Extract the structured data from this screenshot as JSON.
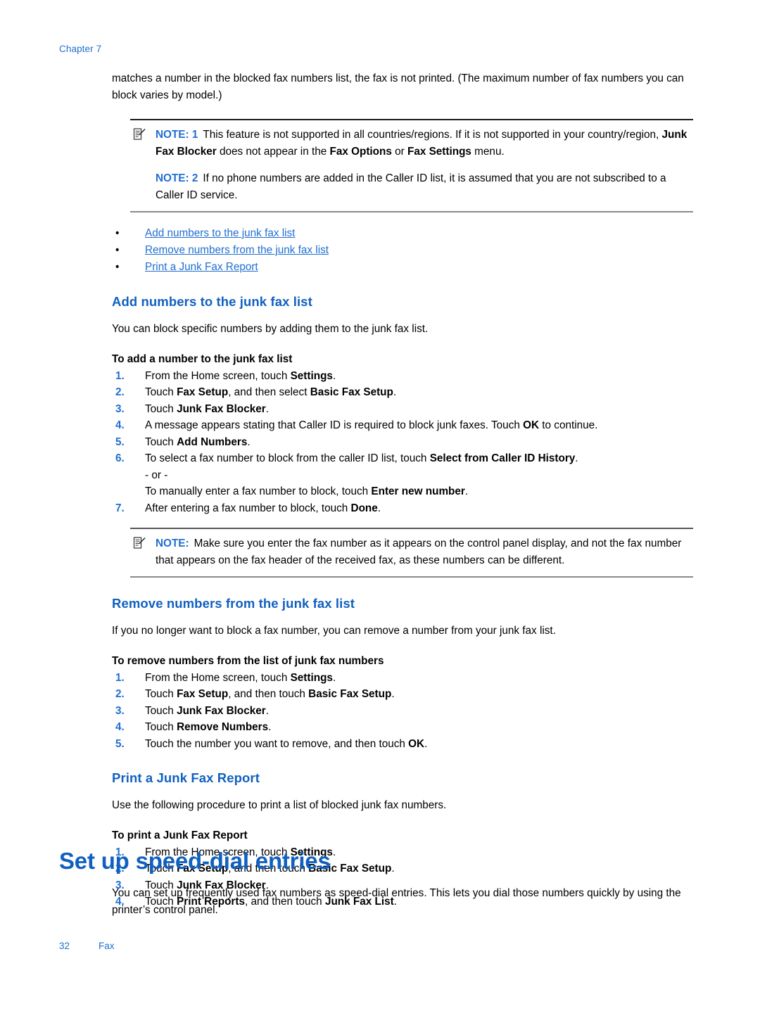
{
  "header": {
    "chapter": "Chapter 7"
  },
  "intro": {
    "paragraph": "matches a number in the blocked fax numbers list, the fax is not printed. (The maximum number of fax numbers you can block varies by model.)"
  },
  "notes_top": {
    "icon_name": "note-pencil-icon",
    "items": [
      {
        "label": "NOTE: 1",
        "text_1": "This feature is not supported in all countries/regions. If it is not supported in your country/region, ",
        "bold_1": "Junk Fax Blocker",
        "text_2": " does not appear in the ",
        "bold_2": "Fax Options",
        "text_3": " or ",
        "bold_3": "Fax Settings",
        "text_4": " menu."
      },
      {
        "label": "NOTE: 2",
        "text_1": "If no phone numbers are added in the Caller ID list, it is assumed that you are not subscribed to a Caller ID service."
      }
    ]
  },
  "links": {
    "bullet_glyph": "•",
    "items": [
      "Add numbers to the junk fax list",
      "Remove numbers from the junk fax list",
      "Print a Junk Fax Report"
    ]
  },
  "section_add": {
    "heading": "Add numbers to the junk fax list",
    "intro": "You can block specific numbers by adding them to the junk fax list.",
    "proc_title": "To add a number to the junk fax list",
    "steps": [
      {
        "num": "1.",
        "pre": "From the Home screen, touch ",
        "bold": "Settings",
        "post": "."
      },
      {
        "num": "2.",
        "pre": "Touch ",
        "bold": "Fax Setup",
        "mid": ", and then select ",
        "bold2": "Basic Fax Setup",
        "post": "."
      },
      {
        "num": "3.",
        "pre": "Touch ",
        "bold": "Junk Fax Blocker",
        "post": "."
      },
      {
        "num": "4.",
        "pre": "A message appears stating that Caller ID is required to block junk faxes. Touch ",
        "bold": "OK",
        "post": " to continue."
      },
      {
        "num": "5.",
        "pre": "Touch ",
        "bold": "Add Numbers",
        "post": "."
      },
      {
        "num": "6.",
        "pre": "To select a fax number to block from the caller ID list, touch ",
        "bold": "Select from Caller ID History",
        "post": ".",
        "or_line": "- or -",
        "alt_pre": "To manually enter a fax number to block, touch ",
        "alt_bold": "Enter new number",
        "alt_post": "."
      },
      {
        "num": "7.",
        "pre": "After entering a fax number to block, touch ",
        "bold": "Done",
        "post": "."
      }
    ]
  },
  "note_middle": {
    "icon_name": "note-pencil-icon",
    "label": "NOTE:",
    "text": "Make sure you enter the fax number as it appears on the control panel display, and not the fax number that appears on the fax header of the received fax, as these numbers can be different."
  },
  "section_remove": {
    "heading": "Remove numbers from the junk fax list",
    "intro": "If you no longer want to block a fax number, you can remove a number from your junk fax list.",
    "proc_title": "To remove numbers from the list of junk fax numbers",
    "steps": [
      {
        "num": "1.",
        "pre": "From the Home screen, touch ",
        "bold": "Settings",
        "post": "."
      },
      {
        "num": "2.",
        "pre": "Touch ",
        "bold": "Fax Setup",
        "mid": ", and then touch ",
        "bold2": "Basic Fax Setup",
        "post": "."
      },
      {
        "num": "3.",
        "pre": "Touch ",
        "bold": "Junk Fax Blocker",
        "post": "."
      },
      {
        "num": "4.",
        "pre": "Touch ",
        "bold": "Remove Numbers",
        "post": "."
      },
      {
        "num": "5.",
        "pre": "Touch the number you want to remove, and then touch ",
        "bold": "OK",
        "post": "."
      }
    ]
  },
  "section_print": {
    "heading": "Print a Junk Fax Report",
    "intro": "Use the following procedure to print a list of blocked junk fax numbers.",
    "proc_title": "To print a Junk Fax Report",
    "steps": [
      {
        "num": "1.",
        "pre": "From the Home screen, touch ",
        "bold": "Settings",
        "post": "."
      },
      {
        "num": "2.",
        "pre": "Touch ",
        "bold": "Fax Setup",
        "mid": ", and then touch ",
        "bold2": "Basic Fax Setup",
        "post": "."
      },
      {
        "num": "3.",
        "pre": "Touch ",
        "bold": "Junk Fax Blocker",
        "post": "."
      },
      {
        "num": "4.",
        "pre": "Touch ",
        "bold": "Print Reports",
        "mid": ", and then touch ",
        "bold2": "Junk Fax List",
        "post": "."
      }
    ]
  },
  "section_speeddial": {
    "heading": "Set up speed-dial entries",
    "paragraph": "You can set up frequently used fax numbers as speed-dial entries. This lets you dial those numbers quickly by using the printer’s control panel."
  },
  "footer": {
    "page_number": "32",
    "section_name": "Fax"
  },
  "colors": {
    "link_blue": "#1f6fd0",
    "heading_blue": "#1060c0",
    "rule_dark": "#1a1a1a",
    "rule_light": "#8a8a8a",
    "text_black": "#000000"
  }
}
